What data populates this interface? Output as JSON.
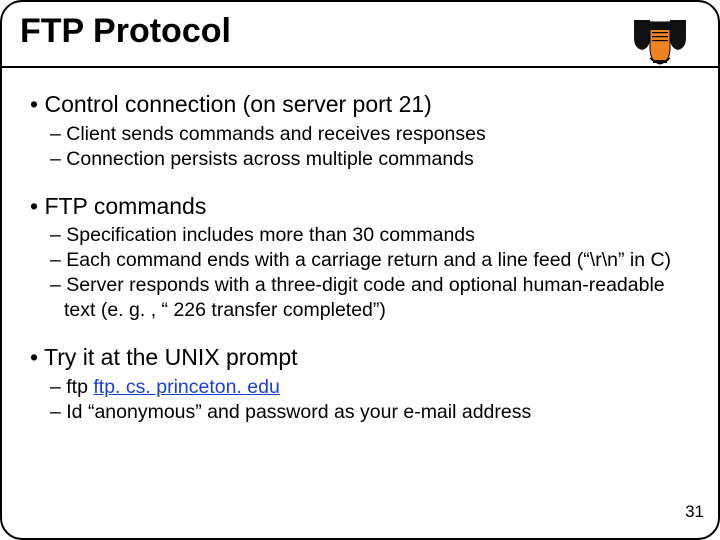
{
  "title": "FTP Protocol",
  "bullets": {
    "b1": "Control connection (on server port 21)",
    "b1s1": "Client sends commands and receives responses",
    "b1s2": "Connection persists across multiple commands",
    "b2": "FTP commands",
    "b2s1": "Specification includes more than 30 commands",
    "b2s2": "Each command ends with a carriage return and a line feed (“\\r\\n” in C)",
    "b2s3": "Server responds with a three-digit code and optional human-readable text (e. g. , “ 226 transfer completed”)",
    "b3": "Try it at the UNIX prompt",
    "b3s1_prefix": "ftp ",
    "b3s1_link": "ftp. cs. princeton. edu",
    "b3s2": "Id “anonymous” and password as your e-mail address"
  },
  "glyphs": {
    "bullet1": "• ",
    "dash": "– "
  },
  "page_number": "31"
}
